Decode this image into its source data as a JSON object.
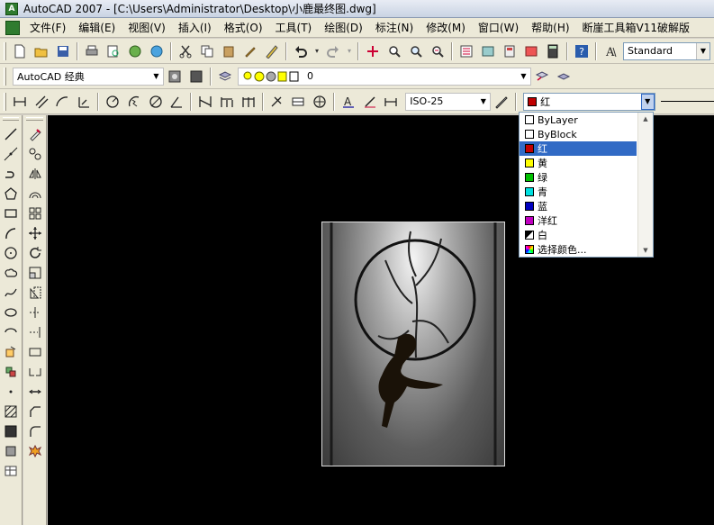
{
  "window": {
    "title": "AutoCAD 2007 - [C:\\Users\\Administrator\\Desktop\\小鹿最终图.dwg]"
  },
  "menu": {
    "items": [
      "文件(F)",
      "编辑(E)",
      "视图(V)",
      "插入(I)",
      "格式(O)",
      "工具(T)",
      "绘图(D)",
      "标注(N)",
      "修改(M)",
      "窗口(W)",
      "帮助(H)",
      "断崖工具箱V11破解版"
    ]
  },
  "toolbar1": {
    "text_style": "Standard"
  },
  "toolbar2": {
    "workspace": "AutoCAD 经典",
    "layer": "0"
  },
  "toolbar3": {
    "dim_style": "ISO-25",
    "color_value": "红"
  },
  "color_list": {
    "items": [
      {
        "label": "ByLayer",
        "color": "#ffffff"
      },
      {
        "label": "ByBlock",
        "color": "#ffffff"
      },
      {
        "label": "红",
        "color": "#c00000",
        "selected": true
      },
      {
        "label": "黄",
        "color": "#ffff00"
      },
      {
        "label": "绿",
        "color": "#00c000"
      },
      {
        "label": "青",
        "color": "#00e0e0"
      },
      {
        "label": "蓝",
        "color": "#0000c0"
      },
      {
        "label": "洋红",
        "color": "#c000c0"
      },
      {
        "label": "白",
        "color": "#000000"
      },
      {
        "label": "选择颜色...",
        "color": "#d0d0d0"
      }
    ]
  },
  "colors": {
    "canvas_bg": "#000000",
    "toolbar_bg": "#ece9d8",
    "selection": "#316ac5"
  }
}
